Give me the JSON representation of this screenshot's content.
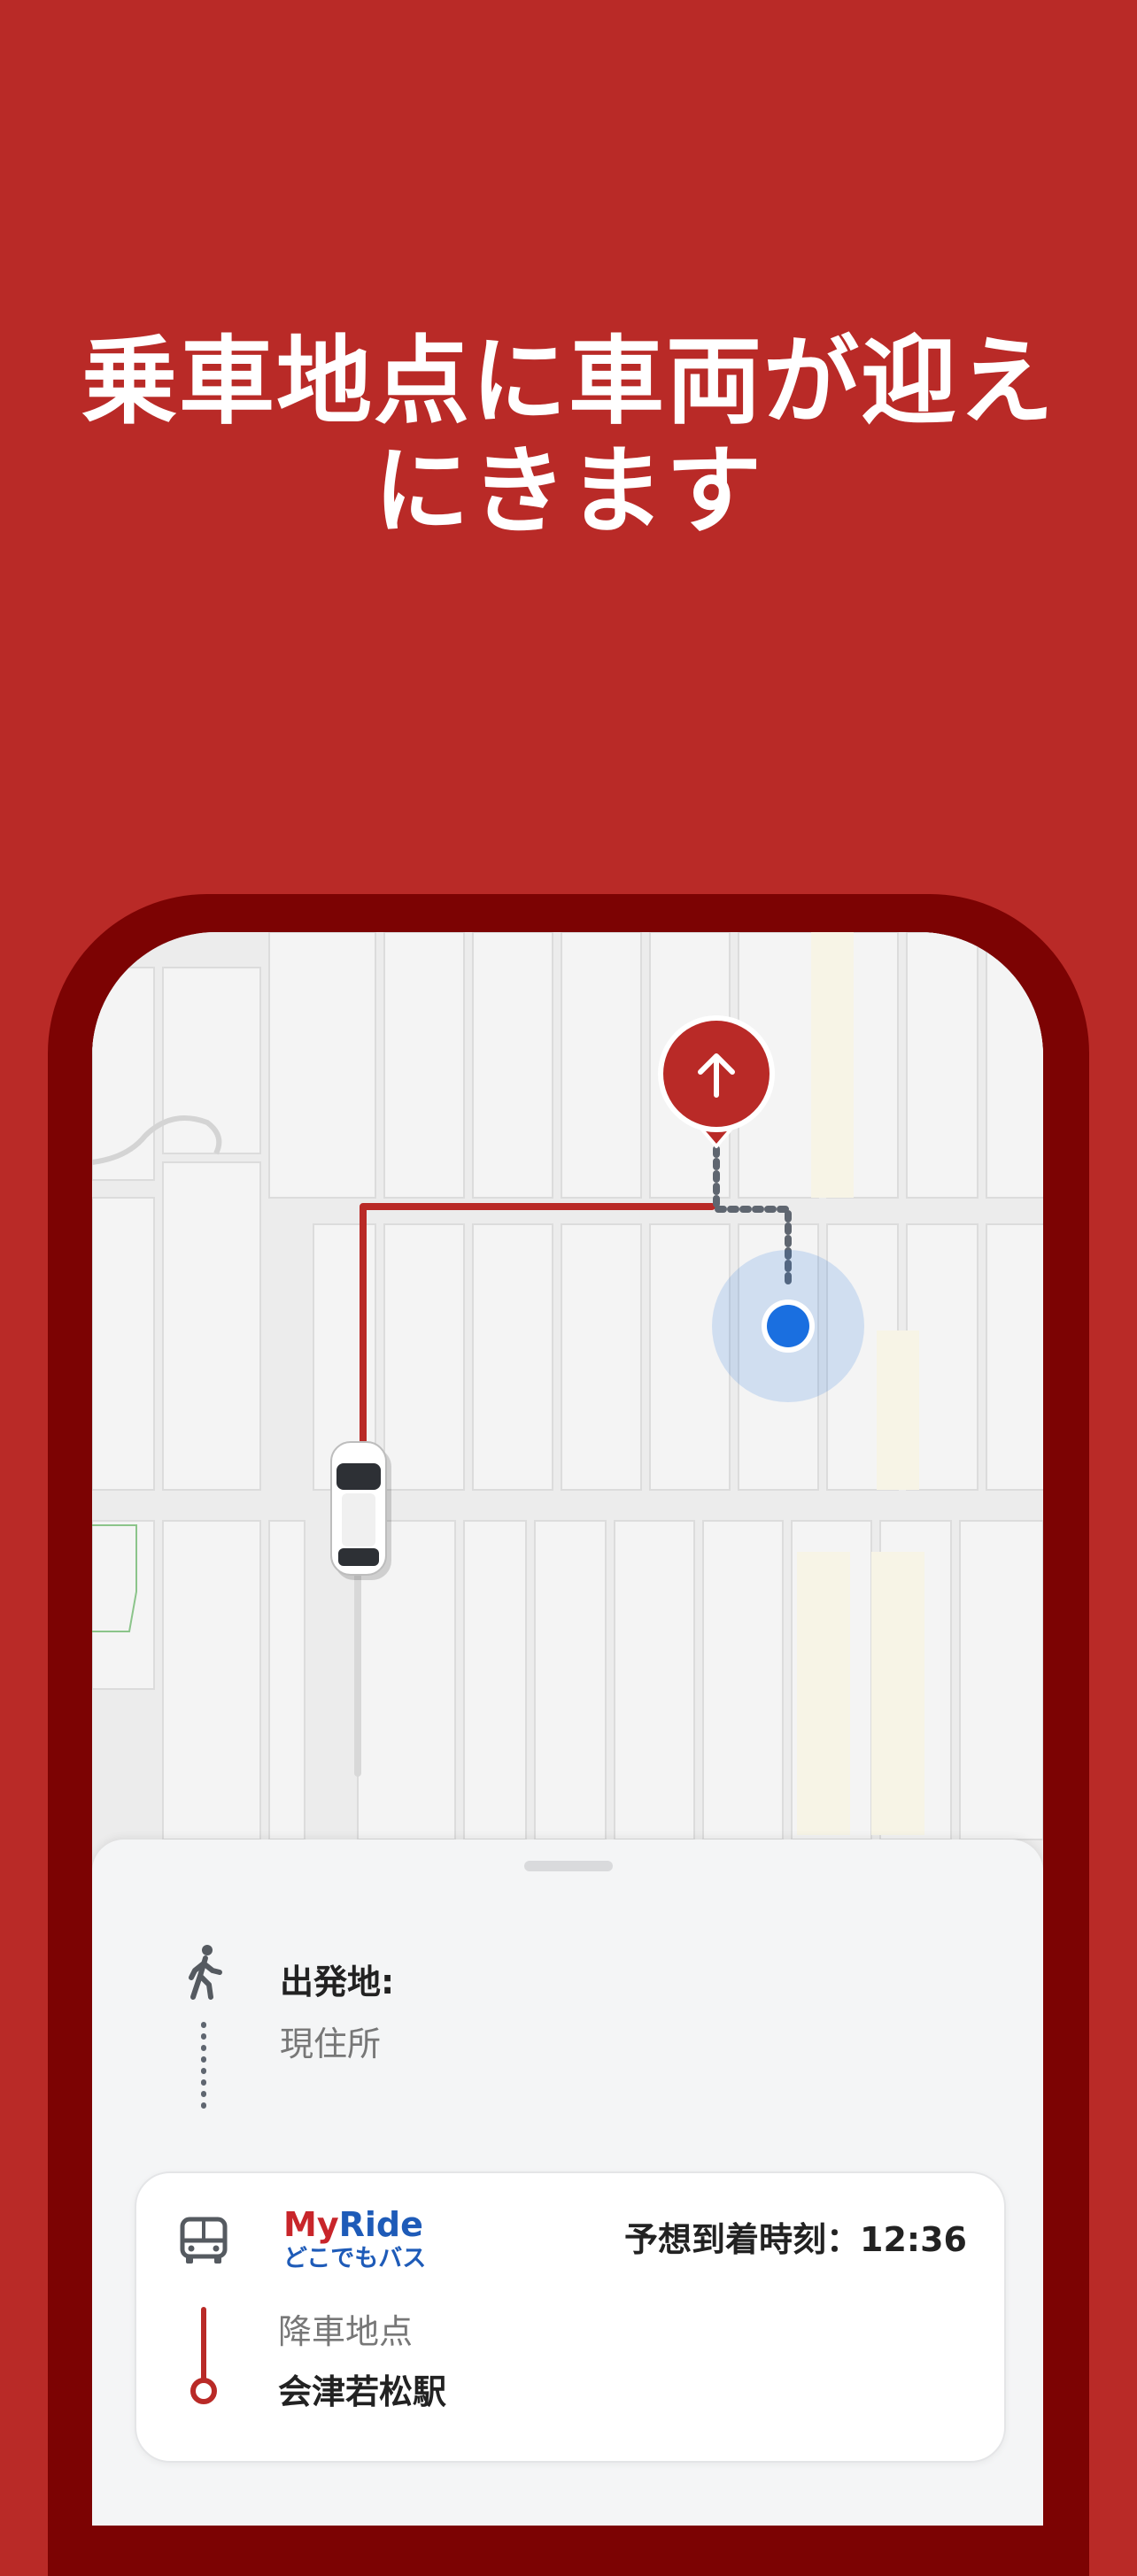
{
  "headline": {
    "line1": "乗車地点に車両が迎え",
    "line2": "にきます"
  },
  "colors": {
    "background": "#b92a27",
    "phone_frame": "#7c0303",
    "route": "#b92a27",
    "user_dot": "#1a6fe0",
    "myride_red": "#c8252a",
    "myride_blue": "#1e5bb8"
  },
  "map": {
    "pickup_pin_icon": "arrow-up-icon",
    "vehicle_icon": "car-icon",
    "user_location_icon": "location-dot-icon"
  },
  "trip": {
    "origin_title": "出発地:",
    "origin_value": "現住所",
    "walk_icon": "walking-person-icon"
  },
  "ride": {
    "bus_icon": "bus-icon",
    "brand_my": "My",
    "brand_ride": "Ride",
    "brand_sub": "どこでもバス",
    "eta_label": "予想到着時刻：",
    "eta_time": "12:36",
    "drop_label": "降車地点",
    "drop_value": "会津若松駅"
  }
}
